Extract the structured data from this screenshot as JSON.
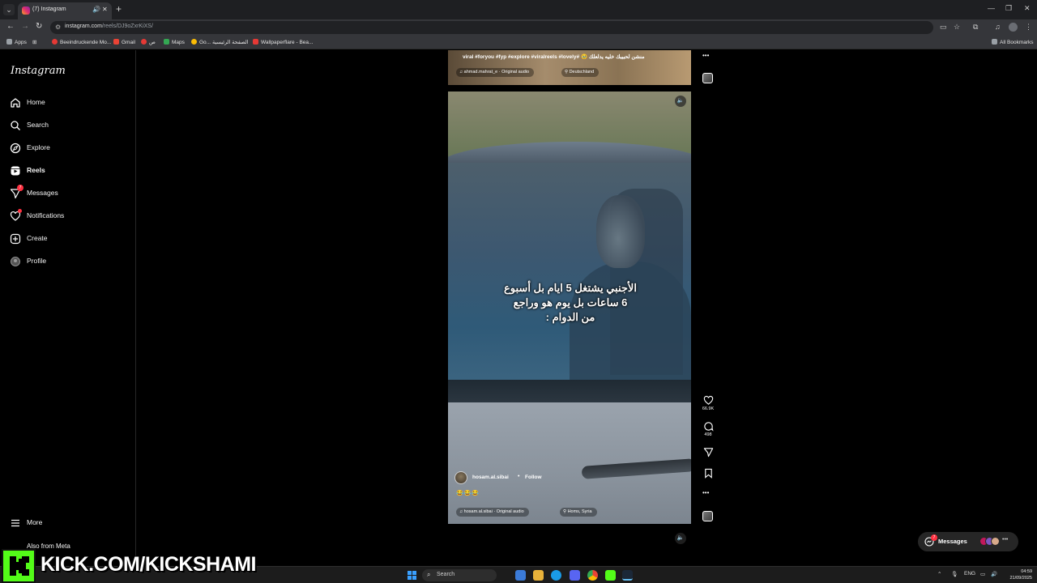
{
  "browser": {
    "tab_title": "(7) Instagram",
    "url_host": "instagram.com",
    "url_path": "/reels/DJ9oZxrKiXS/",
    "bookmarks": [
      {
        "label": "Apps",
        "color": "#9aa0a6"
      },
      {
        "label": "Beeindruckende Mo...",
        "color": "#e53935"
      },
      {
        "label": "Gmail",
        "color": "#ea4335"
      },
      {
        "label": "ص",
        "color": "#e53935"
      },
      {
        "label": "Maps",
        "color": "#34a853"
      },
      {
        "label": "Go...",
        "color": "#fbbc05"
      },
      {
        "label": "الصفحة الرئيسية",
        "color": "#9aa0a6"
      },
      {
        "label": "Wallpaperflare - Bea...",
        "color": "#e53935"
      }
    ],
    "all_bookmarks": "All Bookmarks"
  },
  "sidebar": {
    "logo": "Instagram",
    "items": [
      {
        "label": "Home",
        "icon": "home-icon"
      },
      {
        "label": "Search",
        "icon": "search-icon"
      },
      {
        "label": "Explore",
        "icon": "compass-icon"
      },
      {
        "label": "Reels",
        "icon": "reels-icon"
      },
      {
        "label": "Messages",
        "icon": "messenger-icon",
        "badge": "7"
      },
      {
        "label": "Notifications",
        "icon": "heart-icon"
      },
      {
        "label": "Create",
        "icon": "plus-square-icon"
      },
      {
        "label": "Profile",
        "icon": "avatar-icon"
      }
    ],
    "more": "More",
    "also_from_meta": "Also from Meta"
  },
  "previous_reel": {
    "caption": "viral #foryou #fyp #explore #viralreels #lovely# 🥹 منشن لحبيبك خليه يدلعلك",
    "audio": "ahmad.mahrat_e · Original audio",
    "location": "Deutschland"
  },
  "reel": {
    "overlay_lines": [
      "الأجنبي يشتغل 5 ايام بل أسبوع",
      "6 ساعات بل يوم هو وراجع",
      "من الدوام :"
    ],
    "author": "hosam.al.sibai",
    "follow": "Follow",
    "emojis": "😂😂😂",
    "audio": "hosam.al.sibai · Original audio",
    "location": "Homs, Syria",
    "likes": "66.9K",
    "comments": "498"
  },
  "messages_pill": {
    "label": "Messages",
    "badge": "7"
  },
  "taskbar": {
    "search": "Search",
    "lang": "ENG",
    "time": "04:59",
    "date": "21/09/2025"
  },
  "stream_overlay": {
    "text": "KICK.COM/KICKSHAMI"
  }
}
